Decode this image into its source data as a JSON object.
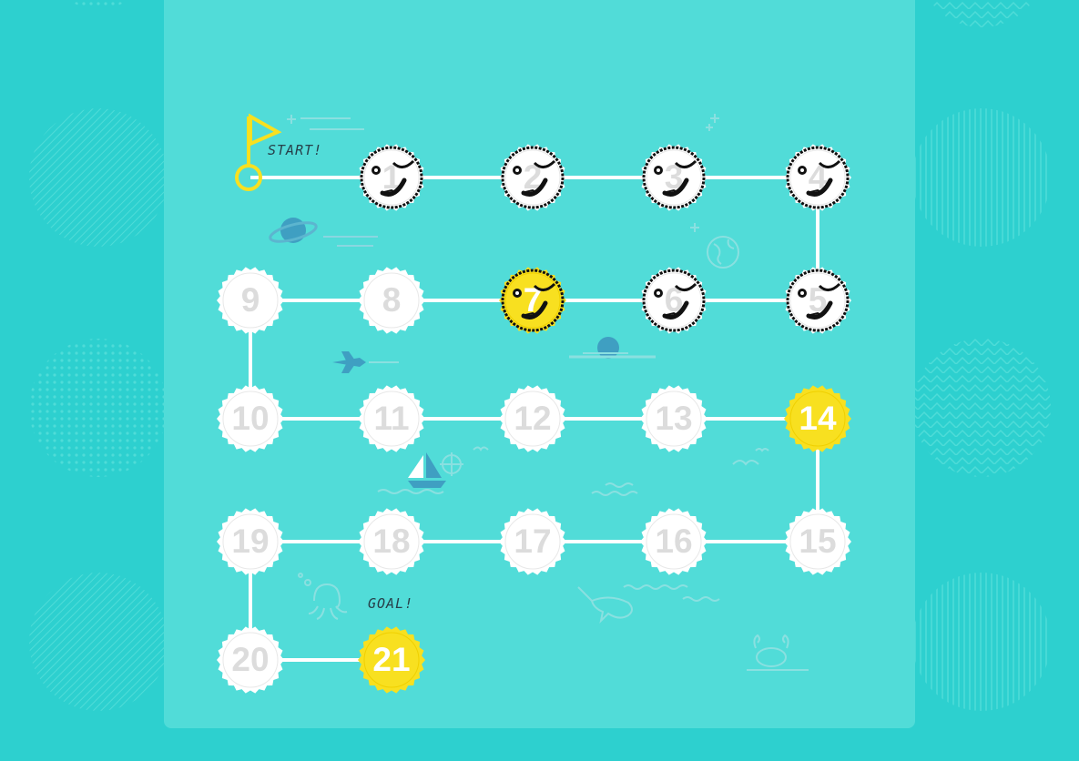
{
  "labels": {
    "start": "START!",
    "goal": "GOAL!"
  },
  "colors": {
    "background": "#2dd0cf",
    "board": "#51dcd8",
    "path": "#ffffff",
    "stamp_plain": "#ffffff",
    "stamp_yellow": "#f8e020",
    "flag": "#f8e020"
  },
  "stamps": [
    {
      "number": "1",
      "state": "stamped",
      "color": "white"
    },
    {
      "number": "2",
      "state": "stamped",
      "color": "white"
    },
    {
      "number": "3",
      "state": "stamped",
      "color": "white"
    },
    {
      "number": "4",
      "state": "stamped",
      "color": "white"
    },
    {
      "number": "5",
      "state": "stamped",
      "color": "white"
    },
    {
      "number": "6",
      "state": "stamped",
      "color": "white"
    },
    {
      "number": "7",
      "state": "stamped",
      "color": "yellow"
    },
    {
      "number": "8",
      "state": "empty",
      "color": "white"
    },
    {
      "number": "9",
      "state": "empty",
      "color": "white"
    },
    {
      "number": "10",
      "state": "empty",
      "color": "white"
    },
    {
      "number": "11",
      "state": "empty",
      "color": "white"
    },
    {
      "number": "12",
      "state": "empty",
      "color": "white"
    },
    {
      "number": "13",
      "state": "empty",
      "color": "white"
    },
    {
      "number": "14",
      "state": "empty",
      "color": "yellow"
    },
    {
      "number": "15",
      "state": "empty",
      "color": "white"
    },
    {
      "number": "16",
      "state": "empty",
      "color": "white"
    },
    {
      "number": "17",
      "state": "empty",
      "color": "white"
    },
    {
      "number": "18",
      "state": "empty",
      "color": "white"
    },
    {
      "number": "19",
      "state": "empty",
      "color": "white"
    },
    {
      "number": "20",
      "state": "empty",
      "color": "white"
    },
    {
      "number": "21",
      "state": "empty",
      "color": "yellow"
    }
  ],
  "icons": [
    "start-flag-icon",
    "planet-icon",
    "globe-icon",
    "airplane-icon",
    "sailboat-icon",
    "compass-icon",
    "octopus-icon",
    "whale-icon",
    "crab-icon",
    "bird-icon",
    "winking-face-icon"
  ]
}
